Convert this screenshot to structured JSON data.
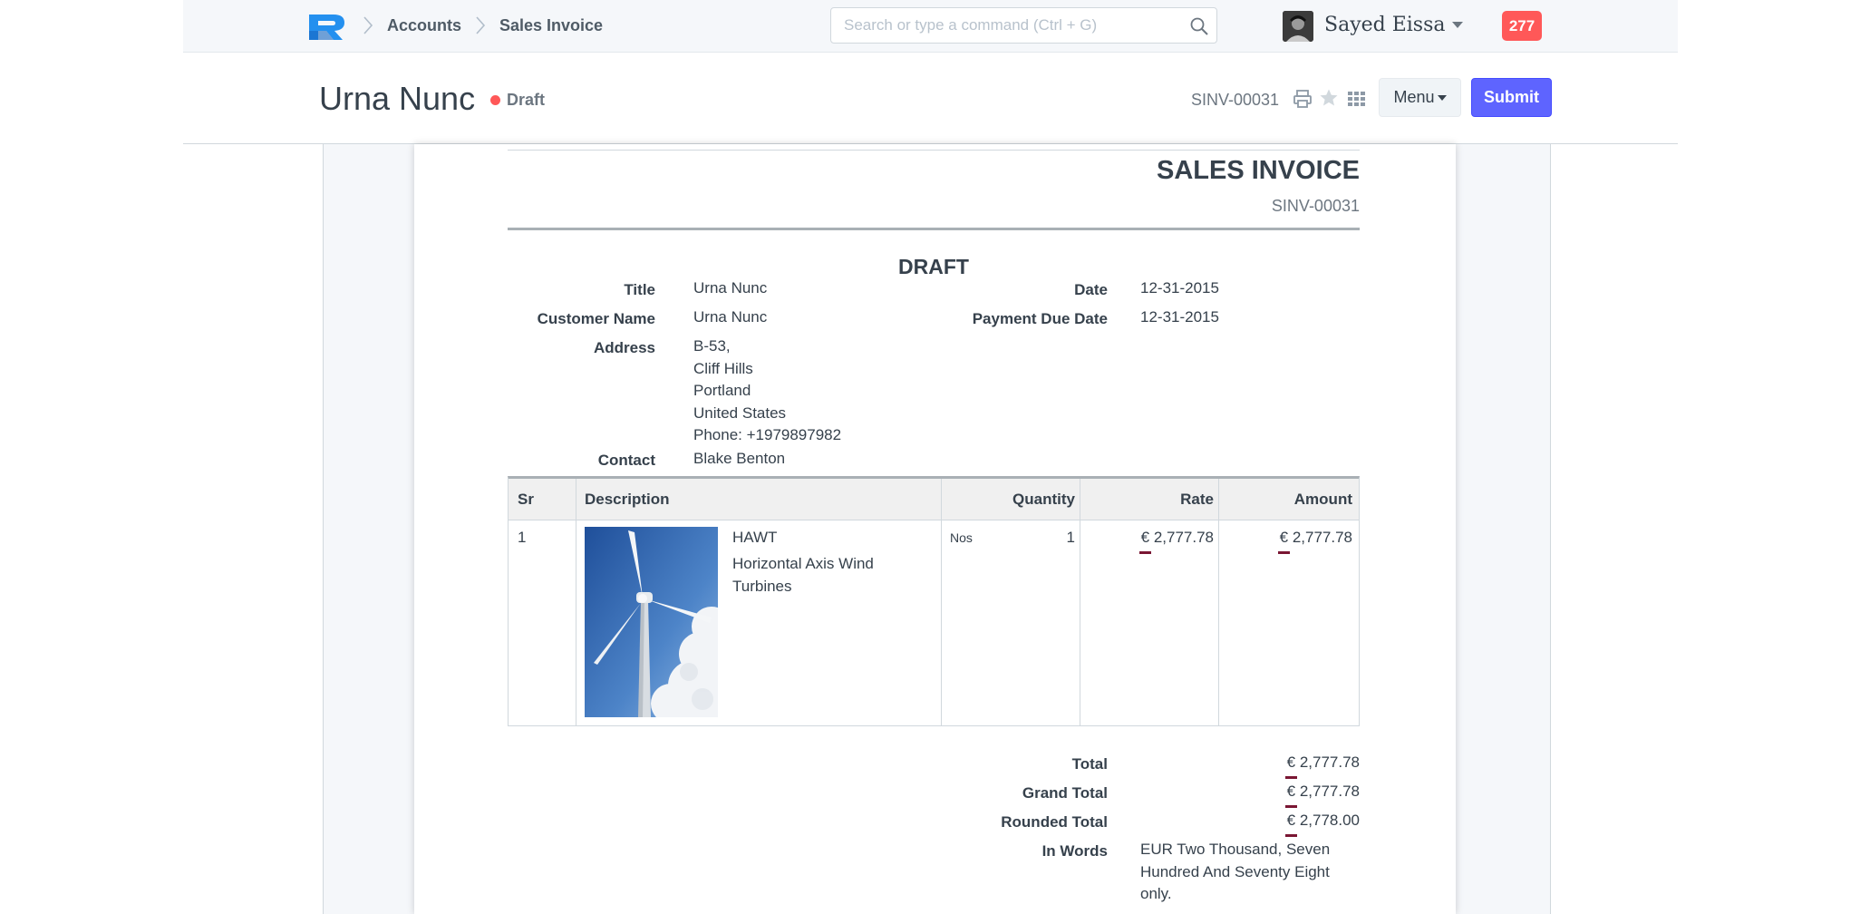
{
  "breadcrumbs": {
    "accounts": "Accounts",
    "sales_invoice": "Sales Invoice"
  },
  "search": {
    "placeholder": "Search or type a command (Ctrl + G)",
    "value": ""
  },
  "user": {
    "name": "Sayed Eissa"
  },
  "notifications": {
    "count": "277"
  },
  "page": {
    "title": "Urna Nunc",
    "status": "Draft",
    "doc_name": "SINV-00031",
    "menu_label": "Menu",
    "submit_label": "Submit"
  },
  "colors": {
    "submit": "#5e64ff",
    "notification": "#ff5858",
    "status_dot": "#ff5858",
    "currency_underline": "#7a1633"
  },
  "icons": [
    "logo",
    "chevron-right-icon",
    "search-icon",
    "caret-down-icon",
    "print-icon",
    "star-icon",
    "grid-icon"
  ],
  "invoice": {
    "heading": "SALES INVOICE",
    "number": "SINV-00031",
    "watermark": "DRAFT",
    "title_label": "Title",
    "title": "Urna Nunc",
    "customer_label": "Customer Name",
    "customer": "Urna Nunc",
    "address_label": "Address",
    "address_lines": [
      "B-53,",
      "Cliff Hills",
      "Portland",
      "United States",
      "Phone: +1979897982"
    ],
    "contact_label": "Contact",
    "contact": "Blake Benton",
    "date_label": "Date",
    "date": "12-31-2015",
    "due_label": "Payment Due Date",
    "due": "12-31-2015",
    "columns": [
      "Sr",
      "Description",
      "Quantity",
      "Rate",
      "Amount"
    ],
    "items": [
      {
        "sr": "1",
        "code": "HAWT",
        "description_lines": [
          "Horizontal Axis Wind",
          "Turbines"
        ],
        "uom": "Nos",
        "qty": "1",
        "rate_currency": "€",
        "rate": "2,777.78",
        "amount_currency": "€",
        "amount": "2,777.78"
      }
    ],
    "totals": {
      "total_label": "Total",
      "total_currency": "€",
      "total": "2,777.78",
      "grand_label": "Grand Total",
      "grand_currency": "€",
      "grand": "2,777.78",
      "rounded_label": "Rounded Total",
      "rounded_currency": "€",
      "rounded": "2,778.00",
      "words_label": "In Words",
      "words_lines": [
        "EUR Two Thousand, Seven",
        "Hundred And Seventy Eight",
        "only."
      ]
    }
  }
}
